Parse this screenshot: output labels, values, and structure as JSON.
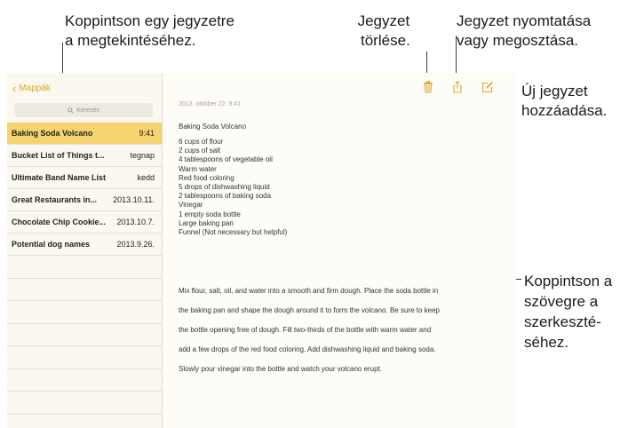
{
  "callouts": {
    "tap_note": [
      "Koppintson egy jegyzetre",
      "a megtekintéséhez."
    ],
    "delete_note": [
      "Jegyzet",
      "törlése."
    ],
    "print_share": [
      "Jegyzet nyomtatása",
      "vagy megosztása."
    ],
    "new_note": [
      "Új jegyzet",
      "hozzáadása."
    ],
    "tap_text": [
      "Koppintson a",
      "szövegre a",
      "szerkeszté-",
      "séhez."
    ]
  },
  "sidebar": {
    "back_label": "Mappák",
    "search_placeholder": "Keresés",
    "notes": [
      {
        "title": "Baking Soda Volcano",
        "date": "9:41",
        "selected": true
      },
      {
        "title": "Bucket List of Things t...",
        "date": "tegnap"
      },
      {
        "title": "Ultimate Band Name List",
        "date": "kedd"
      },
      {
        "title": "Great Restaurants in...",
        "date": "2013.10.11."
      },
      {
        "title": "Chocolate Chip Cookie...",
        "date": "2013.10.7."
      },
      {
        "title": "Potential dog names",
        "date": "2013.9.26."
      }
    ]
  },
  "toolbar": {
    "icons": [
      "trash-icon",
      "share-icon",
      "compose-icon"
    ],
    "accent": "#d8a623"
  },
  "note": {
    "date": "2013. október 22. 9:41",
    "title": "Baking Soda Volcano",
    "ingredients": [
      "6 cups of flour",
      "2 cups of salt",
      "4 tablespoons of vegetable oil",
      "Warm water",
      "Red food coloring",
      "5 drops of dishwashing liquid",
      "2 tablespoons of baking soda",
      "Vinegar",
      "1 empty soda bottle",
      "Large baking pan",
      "Funnel (Not necessary but helpful)"
    ],
    "paragraph_lines": [
      "Mix flour, salt, oil, and water into a smooth and firm dough.  Place the soda bottle in",
      "the baking pan and shape the dough around it to form the volcano.  Be sure to keep",
      "the bottle opening free of dough.  Fill two-thirds of the bottle with warm water and",
      "add a few drops of the red food coloring. Add dishwashing liquid and baking soda.",
      "Slowly pour vinegar into the bottle and watch your volcano erupt."
    ]
  }
}
